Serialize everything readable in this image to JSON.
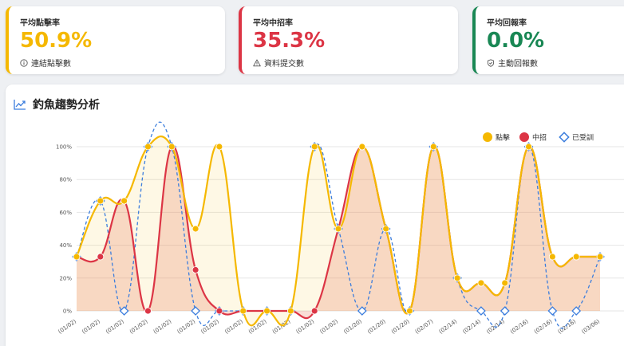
{
  "cards": [
    {
      "label": "平均點擊率",
      "value": "50.9%",
      "sub": "連結點擊數",
      "color": "#f5b800",
      "icon": "info-circle-icon"
    },
    {
      "label": "平均中招率",
      "value": "35.3%",
      "sub": "資料提交數",
      "color": "#dc3545",
      "icon": "warning-triangle-icon"
    },
    {
      "label": "平均回報率",
      "value": "0.0%",
      "sub": "主動回報數",
      "color": "#198754",
      "icon": "shield-check-icon"
    }
  ],
  "panel": {
    "title": "釣魚趨勢分析",
    "icon": "trend-line-icon"
  },
  "chart_data": {
    "type": "line",
    "title": "",
    "xlabel": "",
    "ylabel": "",
    "ylim": [
      0,
      100
    ],
    "yticks": [
      "0%",
      "20%",
      "40%",
      "60%",
      "80%",
      "100%"
    ],
    "grid": true,
    "legend_position": "top-right",
    "categories": [
      "(01/02)",
      "(01/02)",
      "(01/02)",
      "(01/02)",
      "(01/02)",
      "(01/02)",
      "(01/02)",
      "(01/02)",
      "(01/02)",
      "(01/02)",
      "(01/02)",
      "(01/02)",
      "(01/20)",
      "(01/20)",
      "(01/20)",
      "(02/07)",
      "(02/14)",
      "(02/14)",
      "(02/14)",
      "(02/16)",
      "(02/16)",
      "(02/16)",
      "(03/06)"
    ],
    "series": [
      {
        "name": "點擊",
        "color": "#f5b800",
        "style": "solid",
        "fill": "rgba(245,184,0,0.10)",
        "values": [
          33,
          67,
          67,
          100,
          100,
          50,
          100,
          0,
          0,
          0,
          100,
          50,
          100,
          50,
          0,
          100,
          20,
          17,
          17,
          100,
          33,
          33,
          33
        ]
      },
      {
        "name": "中招",
        "color": "#dc3545",
        "style": "solid",
        "fill": "rgba(232,120,90,0.25)",
        "values": [
          33,
          33,
          67,
          0,
          100,
          25,
          0,
          0,
          0,
          0,
          0,
          50,
          100,
          50,
          0,
          100,
          20,
          17,
          17,
          100,
          33,
          33,
          33
        ]
      },
      {
        "name": "已受訓",
        "color": "#3b7ddd",
        "style": "dashed",
        "fill": "none",
        "values": [
          33,
          67,
          0,
          100,
          100,
          0,
          0,
          0,
          0,
          0,
          100,
          50,
          0,
          50,
          0,
          100,
          20,
          0,
          0,
          100,
          0,
          0,
          33
        ]
      }
    ]
  }
}
